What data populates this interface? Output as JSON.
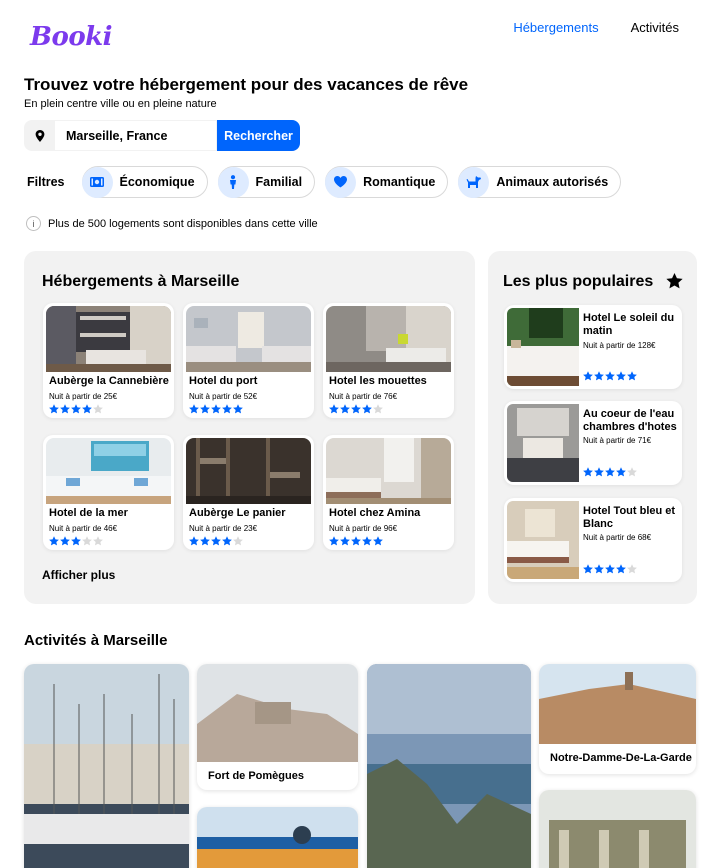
{
  "brand": {
    "logo": "Booki",
    "color": "#7c3aed",
    "accent": "#0065fc"
  },
  "nav": {
    "items": [
      "Hébergements",
      "Activités"
    ],
    "active": 0
  },
  "hero": {
    "title": "Trouvez votre hébergement pour des vacances de rêve",
    "subtitle": "En plein centre ville ou en pleine nature"
  },
  "search": {
    "value": "Marseille, France",
    "button": "Rechercher",
    "icon": "location-pin-icon"
  },
  "filters": {
    "label": "Filtres",
    "items": [
      {
        "label": "Économique",
        "icon": "money-icon"
      },
      {
        "label": "Familial",
        "icon": "person-icon"
      },
      {
        "label": "Romantique",
        "icon": "heart-icon"
      },
      {
        "label": "Animaux autorisés",
        "icon": "dog-icon"
      }
    ]
  },
  "info": "Plus de 500 logements sont disponibles dans cette ville",
  "hebergements": {
    "title": "Hébergements à Marseille",
    "more": "Afficher plus",
    "items": [
      {
        "name": "Aubèrge la Cannebière",
        "price": "Nuit à partir de 25€",
        "rating": 4
      },
      {
        "name": "Hotel du port",
        "price": "Nuit à partir de 52€",
        "rating": 5
      },
      {
        "name": "Hotel les mouettes",
        "price": "Nuit à partir de 76€",
        "rating": 4
      },
      {
        "name": "Hotel de la mer",
        "price": "Nuit à partir de 46€",
        "rating": 3
      },
      {
        "name": "Aubèrge Le panier",
        "price": "Nuit à partir de 23€",
        "rating": 4
      },
      {
        "name": "Hotel chez Amina",
        "price": "Nuit à partir de 96€",
        "rating": 5
      }
    ]
  },
  "populaires": {
    "title": "Les plus populaires",
    "items": [
      {
        "name": "Hotel Le soleil du matin",
        "price": "Nuit à partir de 128€",
        "rating": 5
      },
      {
        "name": "Au coeur de l'eau chambres d'hotes",
        "price": "Nuit à partir de 71€",
        "rating": 4
      },
      {
        "name": "Hotel Tout bleu et Blanc",
        "price": "Nuit à partir de 68€",
        "rating": 4
      }
    ]
  },
  "activites": {
    "title": "Activités à Marseille",
    "items": [
      "Fort de Pomègues",
      "Notre-Damme-De-La-Garde"
    ]
  }
}
